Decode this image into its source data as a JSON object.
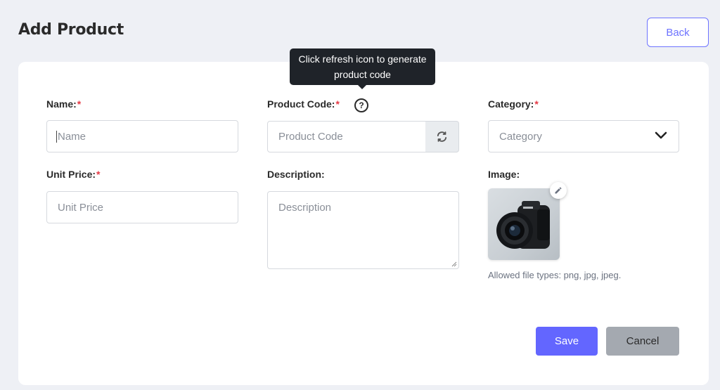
{
  "header": {
    "title": "Add Product",
    "back_label": "Back"
  },
  "tooltip": {
    "line1": "Click refresh icon to generate",
    "line2": "product code"
  },
  "form": {
    "name": {
      "label": "Name:",
      "required": "*",
      "placeholder": "Name",
      "value": ""
    },
    "product_code": {
      "label": "Product Code:",
      "required": "*",
      "placeholder": "Product Code",
      "value": "",
      "help_glyph": "?"
    },
    "category": {
      "label": "Category:",
      "required": "*",
      "selected": "Category"
    },
    "unit_price": {
      "label": "Unit Price:",
      "required": "*",
      "placeholder": "Unit Price",
      "value": ""
    },
    "description": {
      "label": "Description:",
      "placeholder": "Description",
      "value": ""
    },
    "image": {
      "label": "Image:",
      "hint": "Allowed file types: png, jpg, jpeg."
    }
  },
  "actions": {
    "save_label": "Save",
    "cancel_label": "Cancel"
  },
  "colors": {
    "accent": "#6366ff",
    "required": "#e53945",
    "tooltip_bg": "#1f2329",
    "cancel_bg": "#a4a9b0"
  },
  "icons": {
    "help": "help-circle-icon",
    "refresh": "refresh-icon",
    "dropdown": "chevron-down-icon",
    "edit": "pencil-icon"
  }
}
